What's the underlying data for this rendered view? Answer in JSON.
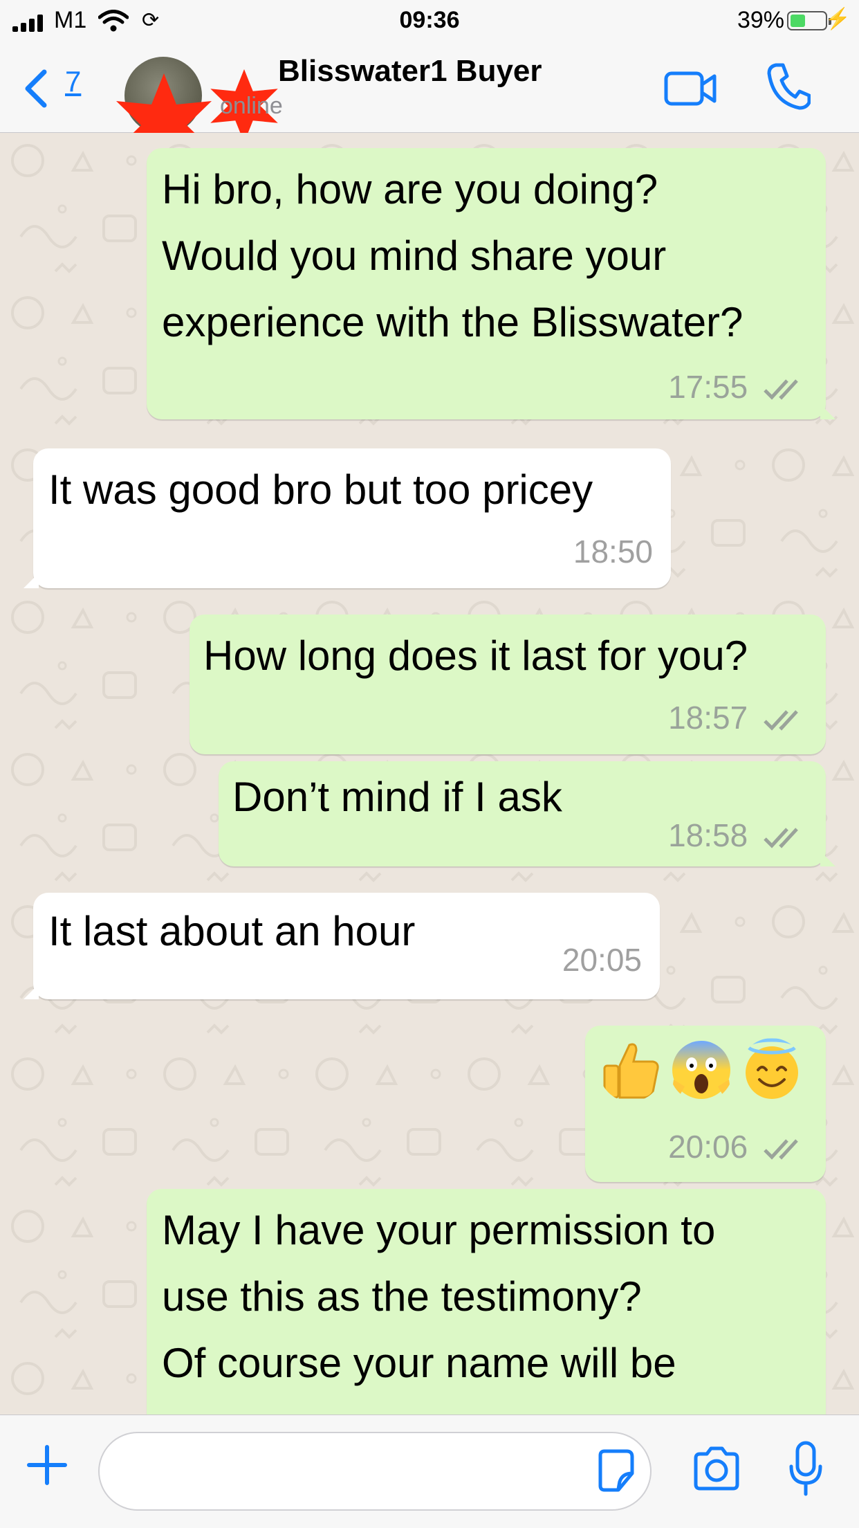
{
  "status_bar": {
    "carrier": "M1",
    "time": "09:36",
    "battery_percent": "39%",
    "battery_level": 0.39,
    "sync_glyph": "⟳",
    "charging_glyph": "⚡"
  },
  "header": {
    "back_count": "7",
    "contact_name": "Blisswater1 Buyer",
    "contact_status": "online",
    "icons": [
      "chevron-left-icon",
      "video-call-icon",
      "phone-icon"
    ]
  },
  "messages": [
    {
      "direction": "outgoing",
      "text": "Hi bro, how are you doing?\nWould you mind share your\nexperience with the Blisswater?",
      "time": "17:55",
      "read": true
    },
    {
      "direction": "incoming",
      "text": "It was good bro but too pricey",
      "time": "18:50"
    },
    {
      "direction": "outgoing",
      "text": "How long does it last for you?",
      "time": "18:57",
      "read": true
    },
    {
      "direction": "outgoing",
      "text": "Don’t mind if I ask",
      "time": "18:58",
      "read": true
    },
    {
      "direction": "incoming",
      "text": "It last about an hour",
      "time": "20:05"
    },
    {
      "direction": "outgoing",
      "emojis": [
        "thumbs-up-emoji",
        "screaming-face-emoji",
        "halo-smile-emoji"
      ],
      "time": "20:06",
      "read": true
    },
    {
      "direction": "outgoing",
      "text": "May I have your permission to\nuse this as the testimony?\nOf course your name will be",
      "time": "",
      "read": false
    }
  ],
  "input_bar": {
    "placeholder": "",
    "icons": [
      "plus-icon",
      "sticker-icon",
      "camera-icon",
      "mic-icon"
    ]
  },
  "colors": {
    "outgoing_bubble": "#dcf8c6",
    "incoming_bubble": "#ffffff",
    "accent_blue": "#157efb",
    "wallpaper": "#ece5dd",
    "redaction_red": "#ff2a10"
  }
}
